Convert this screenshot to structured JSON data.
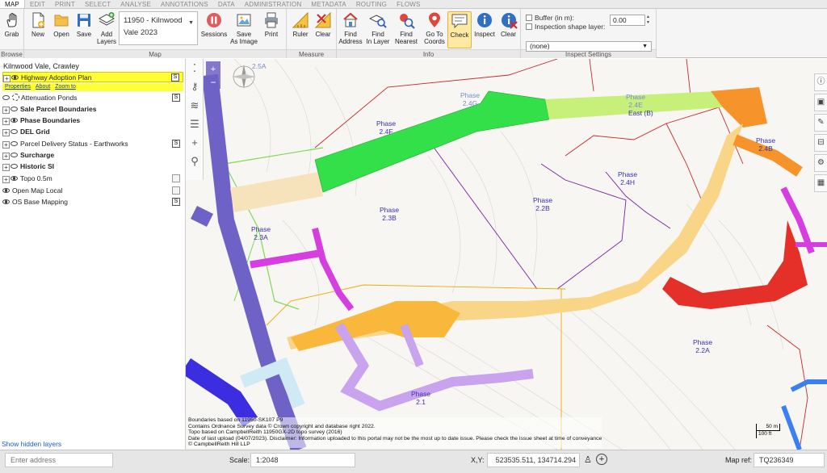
{
  "menu": [
    "MAP",
    "EDIT",
    "PRINT",
    "SELECT",
    "ANALYSE",
    "ANNOTATIONS",
    "DATA",
    "ADMINISTRATION",
    "METADATA",
    "ROUTING",
    "FLOWS"
  ],
  "ribbon": {
    "browse": {
      "grab": "Grab",
      "label": "Browse"
    },
    "map": {
      "new": "New",
      "open": "Open",
      "save": "Save",
      "add_layers": "Add\nLayers",
      "selected_map": "11950 - Kilnwood\nVale 2023",
      "sessions": "Sessions",
      "save_as_image": "Save\nAs Image",
      "print": "Print",
      "label": "Map"
    },
    "measure": {
      "ruler": "Ruler",
      "clear": "Clear",
      "label": "Measure"
    },
    "info": {
      "find_address": "Find\nAddress",
      "find_in_layer": "Find\nIn Layer",
      "find_nearest": "Find\nNearest",
      "go_to_coords": "Go To\nCoords",
      "check": "Check",
      "inspect": "Inspect",
      "clear": "Clear",
      "label": "Info"
    },
    "inspect_settings": {
      "buffer_label": "Buffer (in m):",
      "buffer_value": "0.00",
      "shape_label": "Inspection shape layer:",
      "shape_value": "(none)",
      "label": "Inspect Settings"
    }
  },
  "layer_panel": {
    "title": "Kilnwood Vale, Crawley",
    "layers": [
      {
        "name": "Highway Adoption Plan",
        "bold": false,
        "visible": true,
        "badge": "S",
        "expandable": true
      },
      {
        "name": "Attenuation Ponds",
        "bold": false,
        "visible": false,
        "badge": "S",
        "expandable": false
      },
      {
        "name": "Sale Parcel Boundaries",
        "bold": true,
        "visible": false,
        "badge": "",
        "expandable": true
      },
      {
        "name": "Phase Boundaries",
        "bold": true,
        "visible": true,
        "badge": "",
        "expandable": true
      },
      {
        "name": "DEL Grid",
        "bold": true,
        "visible": false,
        "badge": "",
        "expandable": true
      },
      {
        "name": "Parcel Delivery Status - Earthworks",
        "bold": false,
        "visible": false,
        "badge": "S",
        "expandable": true
      },
      {
        "name": "Surcharge",
        "bold": true,
        "visible": false,
        "badge": "",
        "expandable": true
      },
      {
        "name": "Historic SI",
        "bold": true,
        "visible": false,
        "badge": "",
        "expandable": true
      },
      {
        "name": "Topo 0.5m",
        "bold": false,
        "visible": true,
        "badge": "S",
        "expandable": true
      },
      {
        "name": "Open Map Local",
        "bold": false,
        "visible": true,
        "badge": "S",
        "expandable": false
      },
      {
        "name": "OS Base Mapping",
        "bold": false,
        "visible": true,
        "badge": "S",
        "expandable": false
      }
    ],
    "links": {
      "properties": "Properties",
      "about": "About",
      "zoom_to": "Zoom to"
    },
    "show_hidden": "Show hidden layers"
  },
  "map": {
    "labels": [
      {
        "id": "phase-2-5a",
        "text": "2.5A"
      },
      {
        "id": "phase-2-4g",
        "text": "Phase\n2.4G"
      },
      {
        "id": "phase-2-4f",
        "text": "Phase\n2.4F"
      },
      {
        "id": "phase-2-4e",
        "text": "Phase\n2.4E"
      },
      {
        "id": "east-b",
        "text": "East (B)"
      },
      {
        "id": "phase-2-4b",
        "text": "Phase\n2.4B"
      },
      {
        "id": "phase-2-4h",
        "text": "Phase\n2.4H"
      },
      {
        "id": "phase-2-2b",
        "text": "Phase\n2.2B"
      },
      {
        "id": "phase-2-3b",
        "text": "Phase\n2.3B"
      },
      {
        "id": "phase-2-3a",
        "text": "Phase\n2.3A"
      },
      {
        "id": "phase-2-2a",
        "text": "Phase\n2.2A"
      },
      {
        "id": "phase-2-1",
        "text": "Phase\n2.1"
      }
    ],
    "attribution": [
      "Boundaries based on 11950-SK107 P9",
      "Contains Ordnance Survey data © Crown copyright and database right 2022.",
      "Topo based on CampbellReith 11950GX-2D topo survey (2016)",
      "Date of last upload (04/07/2023). Disclaimer: Information uploaded to this portal may not be the most up to date issue. Please check the issue sheet at time of conveyance",
      "© CampbellReith Hill LLP"
    ],
    "scalebar": {
      "top": "50 m",
      "bottom": "100 ft"
    }
  },
  "status": {
    "address_placeholder": "Enter address",
    "scale_label": "Scale:",
    "scale_value": "1:2048",
    "xy_label": "X,Y:",
    "xy_value": "523535.511, 134714.294",
    "mapref_label": "Map ref:",
    "mapref_value": "TQ236349"
  },
  "colors": {
    "highlight_layer": "#ffff33",
    "road_green": "#33e04a",
    "road_orange": "#f9b73c",
    "road_red": "#e5302a",
    "road_magenta": "#d63ee0",
    "road_purple": "#6f62c7",
    "road_lilac": "#c9a3ee",
    "check_active": "#ffe9a3"
  }
}
